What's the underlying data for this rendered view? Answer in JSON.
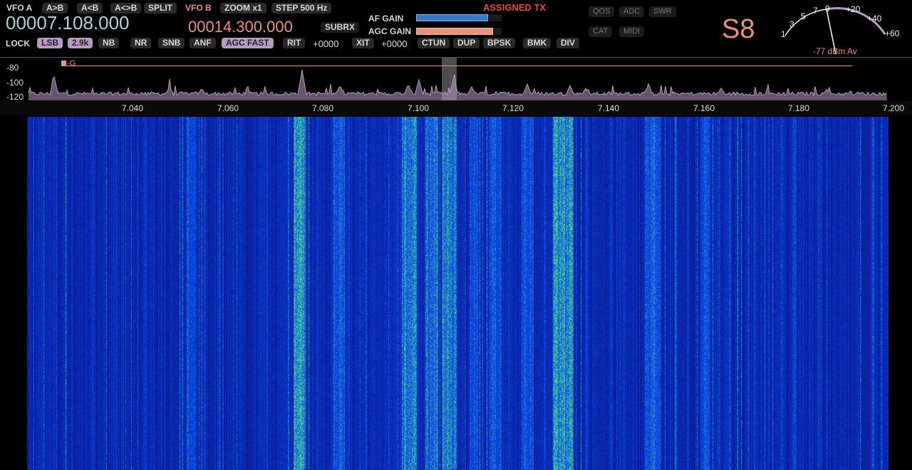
{
  "vfo_a": {
    "label": "VFO A",
    "frequency": "00007.108.000"
  },
  "vfo_b": {
    "label": "VFO B",
    "frequency": "00014.300.000"
  },
  "buttons_top": {
    "a_to_b": "A>B",
    "a_from_b": "A<B",
    "a_swap_b": "A<>B",
    "split": "SPLIT",
    "zoom": "ZOOM x1",
    "step": "STEP 500 Hz",
    "subrx": "SUBRX"
  },
  "assigned_tx": "ASSIGNED TX",
  "gain": {
    "af_label": "AF GAIN",
    "agc_label": "AGC GAIN",
    "af_level": 0.84,
    "agc_level": 0.9,
    "af_color": "#3a78c8",
    "agc_color": "#e8937a"
  },
  "status_buttons": {
    "qos": "QOS",
    "adc": "ADC",
    "swr": "SWR",
    "cat": "CAT",
    "midi": "MIDI"
  },
  "s_meter": {
    "reading": "S8",
    "dbm": "-77 dBm Av",
    "scale": [
      "1",
      "3",
      "5",
      "7",
      "9",
      "+20",
      "+40",
      "+60"
    ]
  },
  "bottom_row": {
    "lock": "LOCK",
    "mode": "LSB",
    "filter": "2.9k",
    "nb": "NB",
    "nr": "NR",
    "snb": "SNB",
    "anf": "ANF",
    "agc": "AGC FAST",
    "rit": "RIT",
    "rit_value": "+0000",
    "xit": "XIT",
    "xit_value": "+0000",
    "ctun": "CTUN",
    "dup": "DUP",
    "bpsk": "BPSK",
    "bmk": "BMK",
    "div": "DIV"
  },
  "panadapter": {
    "db_labels": [
      "-80",
      "-100",
      "-120"
    ],
    "marker": "-G",
    "freq_ticks": [
      "7.040",
      "7.060",
      "7.080",
      "7.100",
      "7.120",
      "7.140",
      "7.160",
      "7.180",
      "7.200"
    ],
    "trace_color": "#b89ac4",
    "marker_color": "#e8937a"
  },
  "colors": {
    "accent_freq_b": "#e8937a",
    "accent_freq_a": "#a9d3d6",
    "button_active": "#b89ac4",
    "assigned_tx": "#e24a4a",
    "waterfall_base": "#0a1fc8",
    "waterfall_hot": "#4de36a"
  }
}
